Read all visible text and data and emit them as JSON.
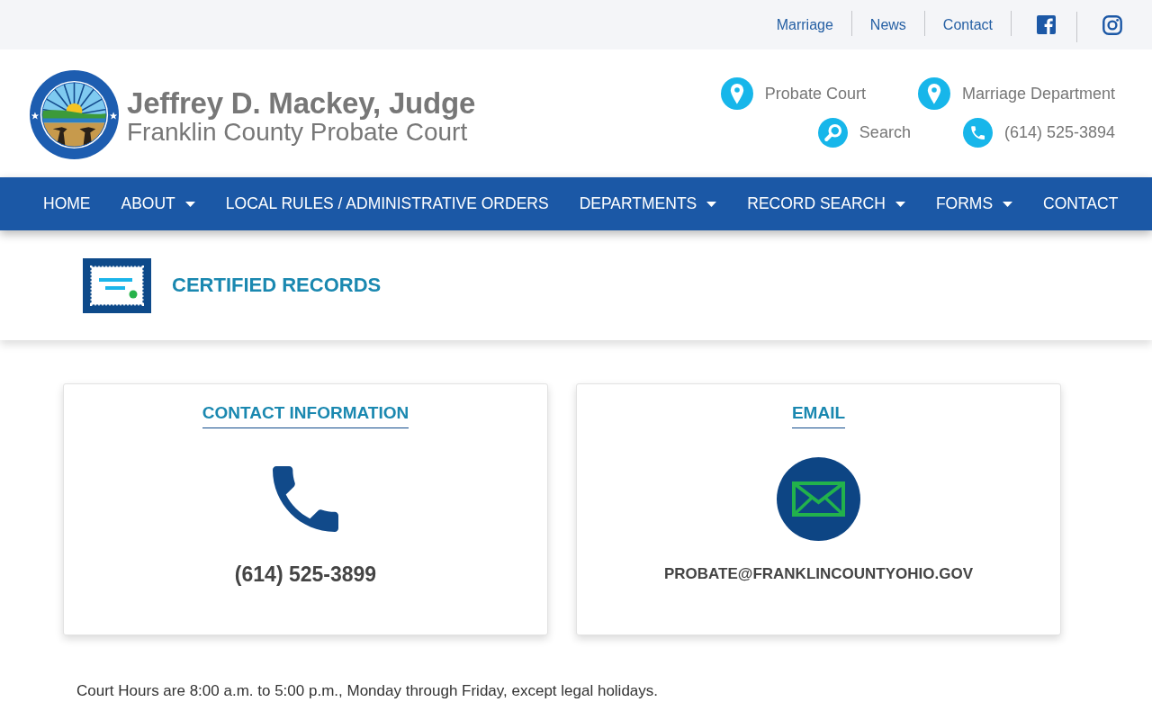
{
  "top_bar": {
    "links": [
      "Marriage",
      "News",
      "Contact"
    ]
  },
  "header": {
    "title": "Jeffrey D. Mackey, Judge",
    "subtitle": "Franklin County Probate Court",
    "quick_link_rows": [
      {
        "items": [
          {
            "kind": "location",
            "label": "Probate Court"
          },
          {
            "kind": "location",
            "label": "Marriage Department"
          }
        ]
      },
      {
        "items": [
          {
            "kind": "search",
            "label": "Search"
          },
          {
            "kind": "phone",
            "label": "(614) 525-3894"
          }
        ]
      }
    ]
  },
  "nav": {
    "items": [
      {
        "label": "HOME",
        "dropdown": false
      },
      {
        "label": "ABOUT",
        "dropdown": true
      },
      {
        "label": "LOCAL RULES / ADMINISTRATIVE ORDERS",
        "dropdown": false
      },
      {
        "label": "DEPARTMENTS",
        "dropdown": true
      },
      {
        "label": "RECORD SEARCH",
        "dropdown": true
      },
      {
        "label": "FORMS",
        "dropdown": true
      },
      {
        "label": "CONTACT",
        "dropdown": false
      }
    ]
  },
  "page_title": {
    "title": "CERTIFIED RECORDS"
  },
  "cards": [
    {
      "kind": "phone",
      "heading": "CONTACT INFORMATION",
      "value": "(614) 525-3899"
    },
    {
      "kind": "email",
      "heading": "EMAIL",
      "value": "PROBATE@FRANKLINCOUNTYOHIO.GOV"
    }
  ],
  "note": "Court Hours are 8:00 a.m. to 5:00 p.m., Monday through Friday, except legal holidays."
}
